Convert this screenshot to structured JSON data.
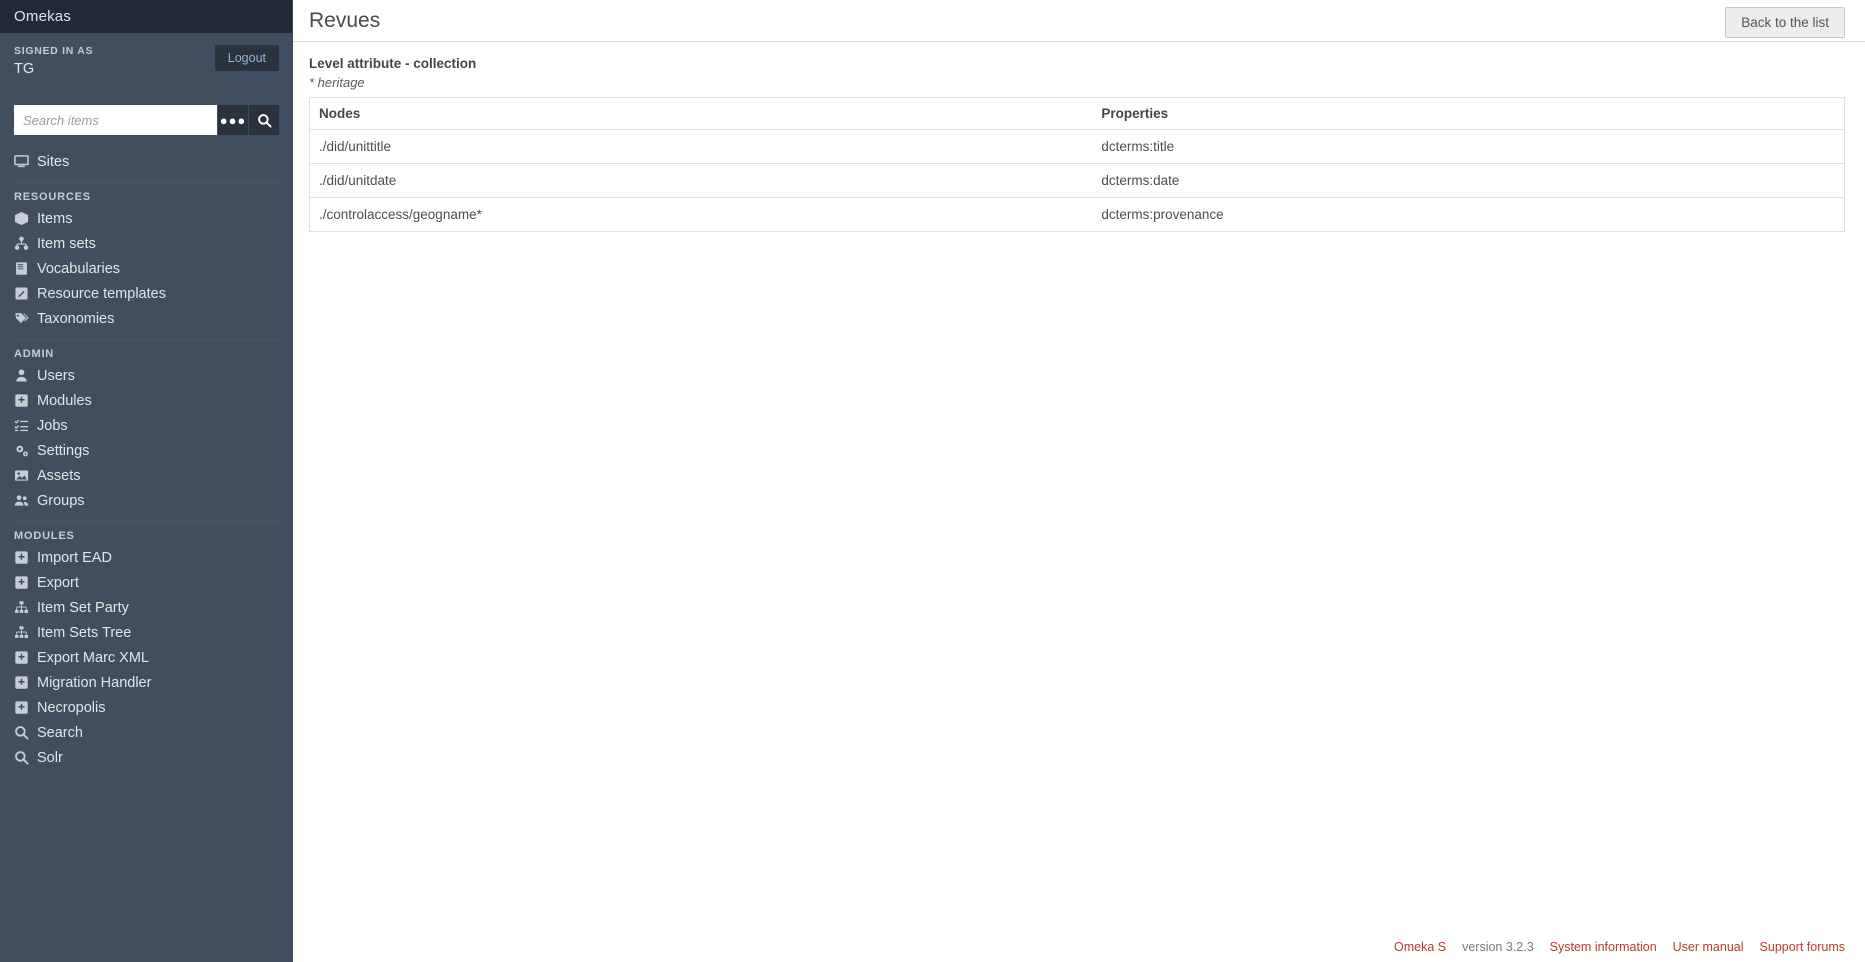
{
  "brand": {
    "title": "Omekas"
  },
  "account": {
    "signed_in_label": "SIGNED IN AS",
    "user": "TG",
    "logout_label": "Logout"
  },
  "search": {
    "placeholder": "Search items",
    "value": "",
    "advanced_icon": "ellipsis-icon",
    "submit_icon": "search-icon"
  },
  "sidebar": {
    "primary": [
      {
        "label": "Sites",
        "icon": "desktop-icon"
      }
    ],
    "sections": [
      {
        "title": "RESOURCES",
        "items": [
          {
            "label": "Items",
            "icon": "cube-icon"
          },
          {
            "label": "Item sets",
            "icon": "sitemap-icon"
          },
          {
            "label": "Vocabularies",
            "icon": "book-icon"
          },
          {
            "label": "Resource templates",
            "icon": "pencil-square-icon"
          },
          {
            "label": "Taxonomies",
            "icon": "tags-icon"
          }
        ]
      },
      {
        "title": "ADMIN",
        "items": [
          {
            "label": "Users",
            "icon": "user-icon"
          },
          {
            "label": "Modules",
            "icon": "puzzle-icon"
          },
          {
            "label": "Jobs",
            "icon": "tasks-icon"
          },
          {
            "label": "Settings",
            "icon": "cogs-icon"
          },
          {
            "label": "Assets",
            "icon": "image-icon"
          },
          {
            "label": "Groups",
            "icon": "users-icon"
          }
        ]
      },
      {
        "title": "MODULES",
        "items": [
          {
            "label": "Import EAD",
            "icon": "puzzle-icon"
          },
          {
            "label": "Export",
            "icon": "puzzle-icon"
          },
          {
            "label": "Item Set Party",
            "icon": "sitemap-icon"
          },
          {
            "label": "Item Sets Tree",
            "icon": "sitemap-icon"
          },
          {
            "label": "Export Marc XML",
            "icon": "puzzle-icon"
          },
          {
            "label": "Migration Handler",
            "icon": "puzzle-icon"
          },
          {
            "label": "Necropolis",
            "icon": "puzzle-icon"
          },
          {
            "label": "Search",
            "icon": "search-icon"
          },
          {
            "label": "Solr",
            "icon": "search-icon"
          }
        ]
      }
    ]
  },
  "page": {
    "title": "Revues",
    "back_button": "Back to the list",
    "level_attribute": "Level attribute - collection",
    "heritage": "* heritage"
  },
  "table": {
    "columns": [
      "Nodes",
      "Properties"
    ],
    "rows": [
      {
        "node": "./did/unittitle",
        "property": "dcterms:title"
      },
      {
        "node": "./did/unitdate",
        "property": "dcterms:date"
      },
      {
        "node": "./controlaccess/geogname*",
        "property": "dcterms:provenance"
      }
    ]
  },
  "footer": {
    "product": "Omeka S",
    "version": "version 3.2.3",
    "links": [
      "System information",
      "User manual",
      "Support forums"
    ]
  }
}
